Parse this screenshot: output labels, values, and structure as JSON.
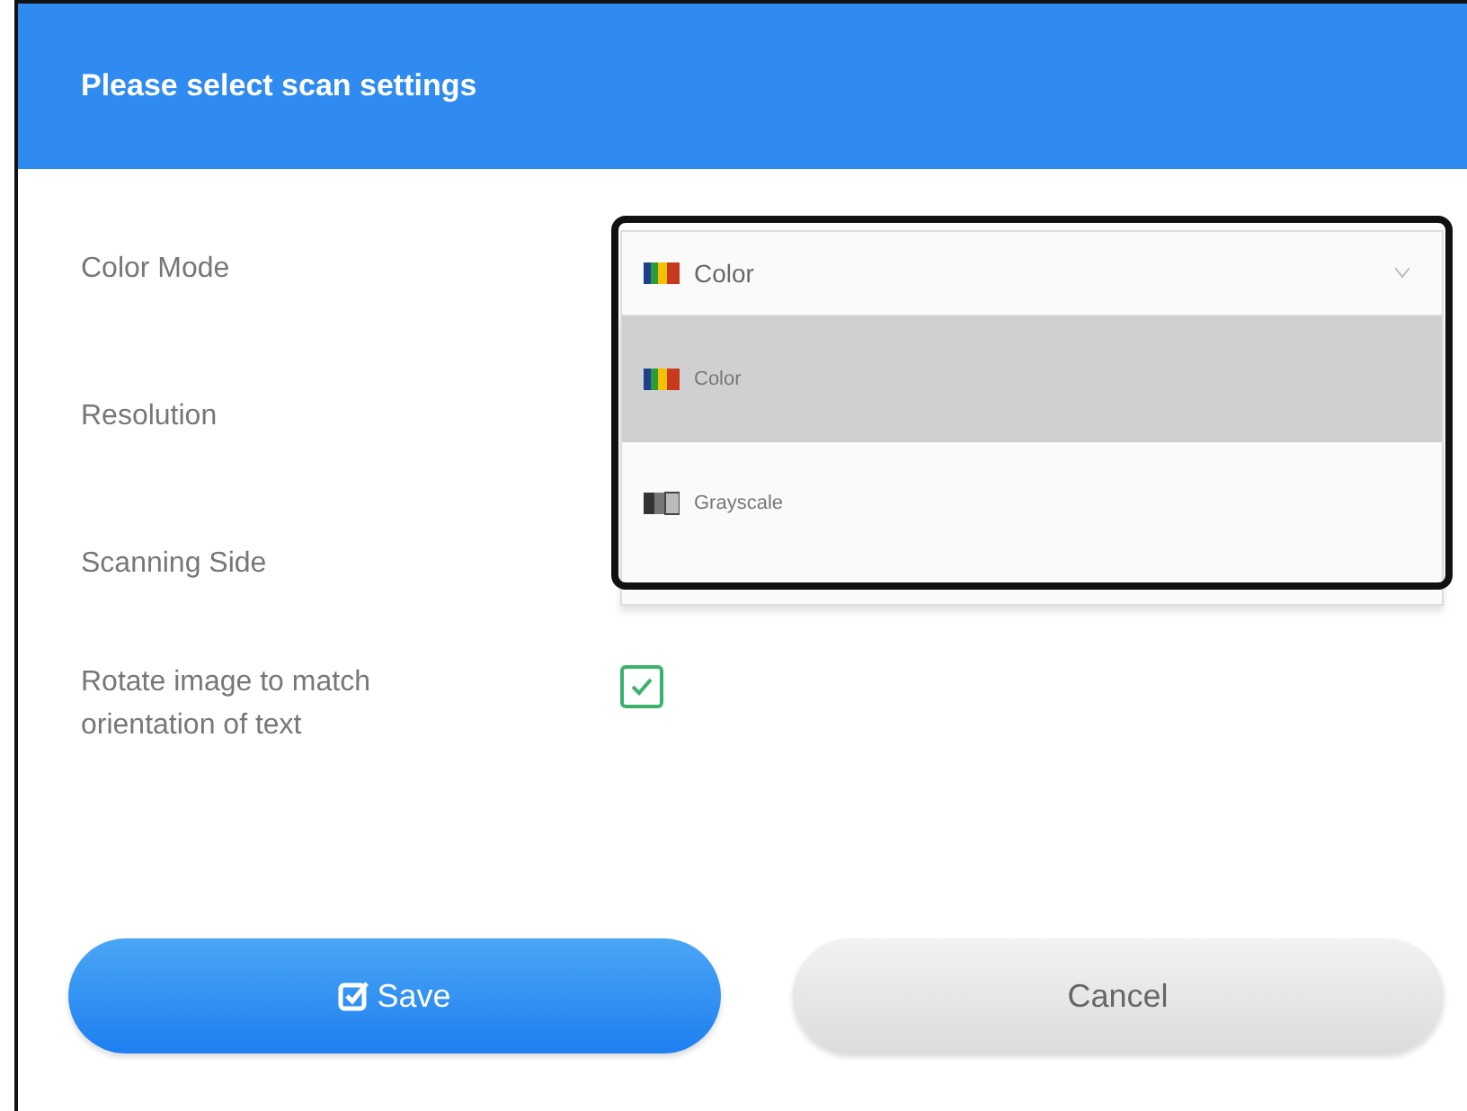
{
  "dialog": {
    "title": "Please select scan settings"
  },
  "fields": [
    {
      "kind": "select",
      "label": "Color Mode",
      "value": "Color",
      "expanded": true,
      "options": [
        {
          "label": "Color",
          "selected": true
        },
        {
          "label": "Grayscale",
          "selected": false
        }
      ]
    },
    {
      "kind": "hidden",
      "label": "Resolution"
    },
    {
      "kind": "hidden",
      "label": "Scanning Side"
    },
    {
      "kind": "checkbox",
      "label": "Rotate image to match orientation of text",
      "checked": true
    }
  ],
  "buttons": [
    {
      "label": "Save",
      "kind": "primary"
    },
    {
      "label": "Cancel",
      "kind": "secondary"
    }
  ]
}
